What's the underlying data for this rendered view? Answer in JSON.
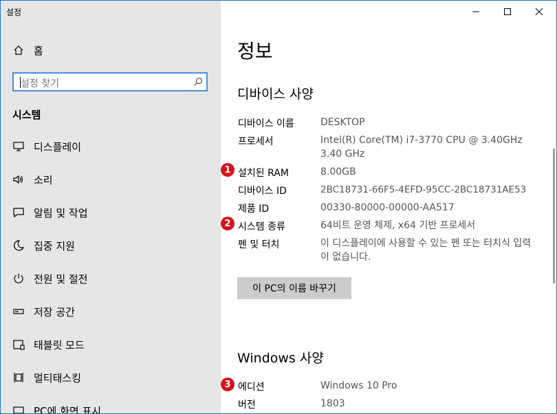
{
  "app_title": "설정",
  "sidebar": {
    "home_label": "홈",
    "search": {
      "placeholder": "설정 찾기"
    },
    "section_title": "시스템",
    "items": [
      {
        "label": "디스플레이",
        "icon": "monitor-icon"
      },
      {
        "label": "소리",
        "icon": "speaker-icon"
      },
      {
        "label": "알림 및 작업",
        "icon": "notification-icon"
      },
      {
        "label": "집중 지원",
        "icon": "moon-icon"
      },
      {
        "label": "전원 및 절전",
        "icon": "power-icon"
      },
      {
        "label": "저장 공간",
        "icon": "storage-icon"
      },
      {
        "label": "태블릿 모드",
        "icon": "tablet-icon"
      },
      {
        "label": "멀티태스킹",
        "icon": "multitasking-icon"
      },
      {
        "label": "PC에 화면 표시",
        "icon": "project-icon"
      }
    ]
  },
  "window_controls": {
    "minimize": "minimize-icon",
    "maximize": "maximize-icon",
    "close": "close-icon"
  },
  "main": {
    "page_title": "정보",
    "device_spec": {
      "title": "디바이스 사양",
      "rows": [
        {
          "label": "디바이스 이름",
          "value": "DESKTOP"
        },
        {
          "label": "프로세서",
          "value": "Intel(R) Core(TM) i7-3770 CPU @ 3.40GHz 3.40 GHz"
        },
        {
          "label": "설치된 RAM",
          "value": "8.00GB"
        },
        {
          "label": "디바이스 ID",
          "value": "2BC18731-66F5-4EFD-95CC-2BC18731AE53"
        },
        {
          "label": "제품 ID",
          "value": "00330-80000-00000-AA517"
        },
        {
          "label": "시스템 종류",
          "value": "64비트 운영 체제, x64 기반 프로세서"
        },
        {
          "label": "펜 및 터치",
          "value": "이 디스플레이에 사용할 수 있는 펜 또는 터치식 입력이 없습니다."
        }
      ]
    },
    "rename_button": "이 PC의 이름 바꾸기",
    "windows_spec": {
      "title": "Windows 사양",
      "rows": [
        {
          "label": "에디션",
          "value": "Windows 10 Pro"
        },
        {
          "label": "버전",
          "value": "1803"
        }
      ]
    },
    "badges": [
      "1",
      "2",
      "3"
    ],
    "badge_color": "#d4141c"
  }
}
